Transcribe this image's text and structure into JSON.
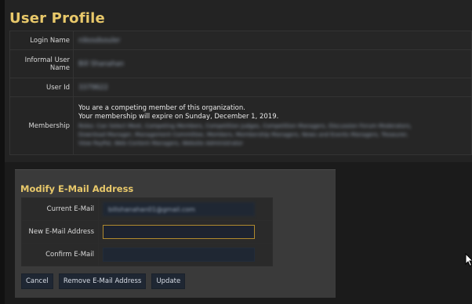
{
  "page": {
    "title": "User Profile"
  },
  "profile": {
    "rows": [
      {
        "label": "Login Name",
        "value": "nikosdsouler"
      },
      {
        "label": "Informal User Name",
        "value": "Bill Shanahan"
      },
      {
        "label": "User Id",
        "value": "3379622"
      },
      {
        "label": "Membership",
        "line1": "You are a competing member of this organization.",
        "line2": "Your membership will expire on Sunday, December 1, 2019.",
        "roles_line1": "Roles: Can Select Meet, Competing Members, Competition Judges, Competition Managers, Discussion Forum Moderators,",
        "roles_line2": "Download Manager, Management Committee, Members, Membership Managers, News and Events Managers, Treasurer,",
        "roles_line3": "View PayPal, Web Content Managers, Website Administrator"
      }
    ]
  },
  "email_form": {
    "title": "Modify E-Mail Address",
    "current_label": "Current E-Mail",
    "current_value": "billshanahan01@gmail.com",
    "new_label": "New E-Mail Address",
    "new_value": "",
    "confirm_label": "Confirm E-Mail",
    "confirm_value": "",
    "buttons": {
      "cancel": "Cancel",
      "remove": "Remove E-Mail Address",
      "update": "Update"
    }
  },
  "colors": {
    "title_gold": "#e8c86a",
    "panel_bg": "#232323",
    "form_bg": "#3a3a3a",
    "field_bg": "#1f2733",
    "focus_border": "#b08a2e"
  },
  "icons": {
    "cursor": "mouse-pointer-icon"
  }
}
